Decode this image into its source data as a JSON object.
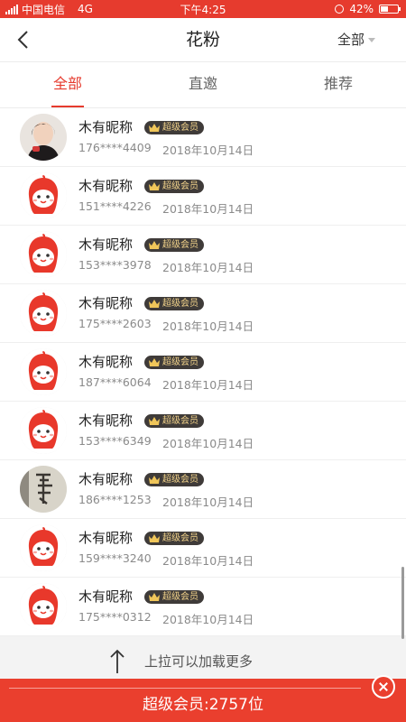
{
  "status_bar": {
    "carrier": "中国电信",
    "network": "4G",
    "time": "下午4:25",
    "battery": "42%",
    "battery_level": 0.42
  },
  "header": {
    "title": "花粉",
    "filter_label": "全部"
  },
  "tabs": [
    {
      "label": "全部",
      "active": true
    },
    {
      "label": "直邀",
      "active": false
    },
    {
      "label": "推荐",
      "active": false
    }
  ],
  "members": [
    {
      "name": "木有昵称",
      "badge": "超级会员",
      "phone": "176****4409",
      "date": "2018年10月14日",
      "avatar": "photo-avatar"
    },
    {
      "name": "木有昵称",
      "badge": "超级会员",
      "phone": "151****4226",
      "date": "2018年10月14日",
      "avatar": "mascot-avatar"
    },
    {
      "name": "木有昵称",
      "badge": "超级会员",
      "phone": "153****3978",
      "date": "2018年10月14日",
      "avatar": "mascot-avatar"
    },
    {
      "name": "木有昵称",
      "badge": "超级会员",
      "phone": "175****2603",
      "date": "2018年10月14日",
      "avatar": "mascot-avatar"
    },
    {
      "name": "木有昵称",
      "badge": "超级会员",
      "phone": "187****6064",
      "date": "2018年10月14日",
      "avatar": "mascot-avatar"
    },
    {
      "name": "木有昵称",
      "badge": "超级会员",
      "phone": "153****6349",
      "date": "2018年10月14日",
      "avatar": "mascot-avatar"
    },
    {
      "name": "木有昵称",
      "badge": "超级会员",
      "phone": "186****1253",
      "date": "2018年10月14日",
      "avatar": "calligraphy-avatar"
    },
    {
      "name": "木有昵称",
      "badge": "超级会员",
      "phone": "159****3240",
      "date": "2018年10月14日",
      "avatar": "mascot-avatar"
    },
    {
      "name": "木有昵称",
      "badge": "超级会员",
      "phone": "175****0312",
      "date": "2018年10月14日",
      "avatar": "mascot-avatar"
    }
  ],
  "load_more": {
    "text": "上拉可以加载更多",
    "icon": "up-arrow-icon"
  },
  "banner": {
    "text": "超级会员:2757位"
  },
  "colors": {
    "accent": "#e63b2e",
    "badge_bg": "#3f3b39",
    "badge_text": "#f1d28a"
  }
}
